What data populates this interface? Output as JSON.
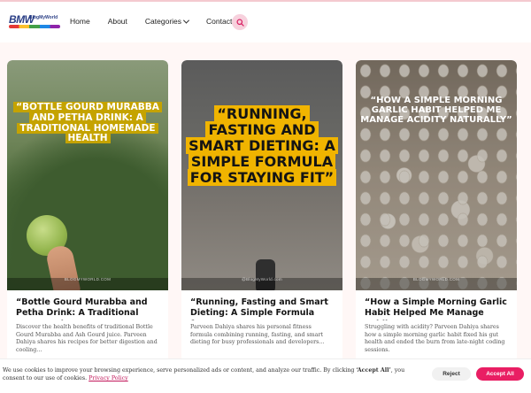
{
  "header": {
    "logo_mark": "BMW",
    "logo_small": "BlogMyWorld",
    "nav": {
      "home": "Home",
      "about": "About",
      "categories": "Categories",
      "contact": "Contact"
    }
  },
  "cards": [
    {
      "overlay_title": "“BOTTLE GOURD MURABBA AND PETHA DRINK: A TRADITIONAL HOMEMADE HEALTH",
      "watermark": "BLOGMYWORLD.COM",
      "title": "“Bottle Gourd Murabba and Petha Drink: A Traditional Homemade…",
      "excerpt": "Discover the health benefits of traditional Bottle Gourd Murabba and Ash Gourd juice. Parveen Dahiya shares his recipes for better digestion and cooling…"
    },
    {
      "overlay_title": "“RUNNING, FASTING AND SMART DIETING: A SIMPLE FORMULA FOR STAYING FIT”",
      "watermark": "@BlogMyWorld.com",
      "title": "“Running, Fasting and Smart Dieting: A Simple Formula for…",
      "excerpt": "Parveen Dahiya shares his personal fitness formula combining running, fasting, and smart dieting for busy professionals and developers…"
    },
    {
      "overlay_title": "“HOW A SIMPLE MORNING GARLIC HABIT HELPED ME MANAGE ACIDITY NATURALLY”",
      "watermark": "BLOGMYWORLD.COM",
      "title": "“How a Simple Morning Garlic Habit Helped Me Manage Acidity…",
      "excerpt": "Struggling with acidity? Parveen Dahiya shares how a simple morning garlic habit fixed his gut health and ended the burn from late-night coding sessions."
    }
  ],
  "cookie": {
    "text_before": "We use cookies to improve your browsing experience, serve personalized ads or content, and analyze our traffic. By clicking ",
    "text_bold": "‘Accept All’",
    "text_after": ", you consent to our use of cookies.",
    "policy_link": "Privacy Policy",
    "reject_label": "Reject",
    "accept_label": "Accept All"
  },
  "colors": {
    "accent": "#e91e63",
    "page_bg": "#fff7f6"
  }
}
